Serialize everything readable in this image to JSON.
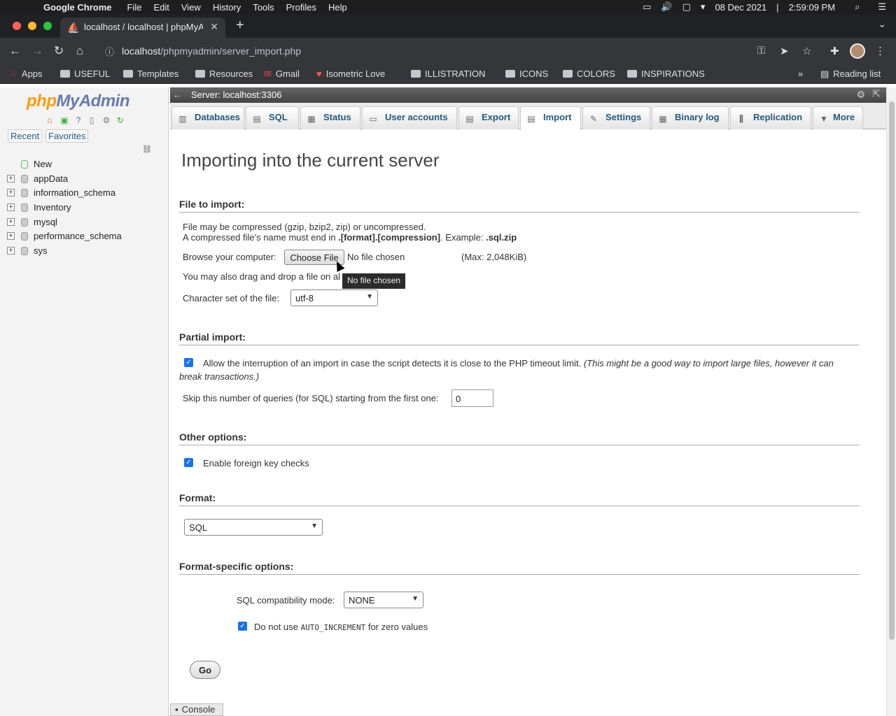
{
  "menubar": {
    "app_name": "Google Chrome",
    "items": [
      "File",
      "Edit",
      "View",
      "History",
      "Tools",
      "Profiles",
      "Help"
    ],
    "date": "08 Dec 2021",
    "time": "2:59:09 PM"
  },
  "browser": {
    "tab_title": "localhost / localhost | phpMyA",
    "url_host": "localhost",
    "url_path": "/phpmyadmin/server_import.php"
  },
  "bookmarks": {
    "apps": "Apps",
    "items": [
      "USEFUL",
      "Templates",
      "Resources",
      "Gmail",
      "Isometric Love",
      "ILLISTRATION",
      "ICONS",
      "COLORS",
      "INSPIRATIONS"
    ],
    "reading_list": "Reading list"
  },
  "sidebar": {
    "logo_php": "php",
    "logo_myadmin": "MyAdmin",
    "recent": "Recent",
    "favorites": "Favorites",
    "new": "New",
    "databases": [
      "appData",
      "information_schema",
      "Inventory",
      "mysql",
      "performance_schema",
      "sys"
    ]
  },
  "topbar": {
    "server": "Server: localhost:3306"
  },
  "tabs": [
    {
      "label": "Databases",
      "icon": "database-icon"
    },
    {
      "label": "SQL",
      "icon": "sql-icon"
    },
    {
      "label": "Status",
      "icon": "status-icon"
    },
    {
      "label": "User accounts",
      "icon": "users-icon"
    },
    {
      "label": "Export",
      "icon": "export-icon"
    },
    {
      "label": "Import",
      "icon": "import-icon"
    },
    {
      "label": "Settings",
      "icon": "wrench-icon"
    },
    {
      "label": "Binary log",
      "icon": "log-icon"
    },
    {
      "label": "Replication",
      "icon": "replication-icon"
    },
    {
      "label": "More",
      "icon": "chevron-down-icon"
    }
  ],
  "main": {
    "page_title": "Importing into the current server",
    "file_section": "File to import:",
    "compress_line1": "File may be compressed (gzip, bzip2, zip) or uncompressed.",
    "compress_line2a": "A compressed file's name must end in ",
    "compress_line2b": ".[format].[compression]",
    "compress_line2c": ". Example: ",
    "compress_line2d": ".sql.zip",
    "browse_label": "Browse your computer:",
    "choose_file": "Choose File",
    "no_file": "No file chosen",
    "max_size": "(Max: 2,048KiB)",
    "drag_drop": "You may also drag and drop a file on al",
    "tooltip": "No file chosen",
    "charset_label": "Character set of the file:",
    "charset_value": "utf-8",
    "partial_section": "Partial import:",
    "allow_interrupt": "Allow the interruption of an import in case the script detects it is close to the PHP timeout limit.",
    "allow_interrupt_note1": "(This might be a good way to import large files, however it can",
    "allow_interrupt_note2": "break transactions.)",
    "skip_label": "Skip this number of queries (for SQL) starting from the first one:",
    "skip_value": "0",
    "other_section": "Other options:",
    "foreign_keys": "Enable foreign key checks",
    "format_section": "Format:",
    "format_value": "SQL",
    "format_specific_section": "Format-specific options:",
    "compat_label": "SQL compatibility mode:",
    "compat_value": "NONE",
    "auto_inc_a": "Do not use ",
    "auto_inc_code": "AUTO_INCREMENT",
    "auto_inc_b": " for zero values",
    "go": "Go"
  },
  "console": "Console"
}
